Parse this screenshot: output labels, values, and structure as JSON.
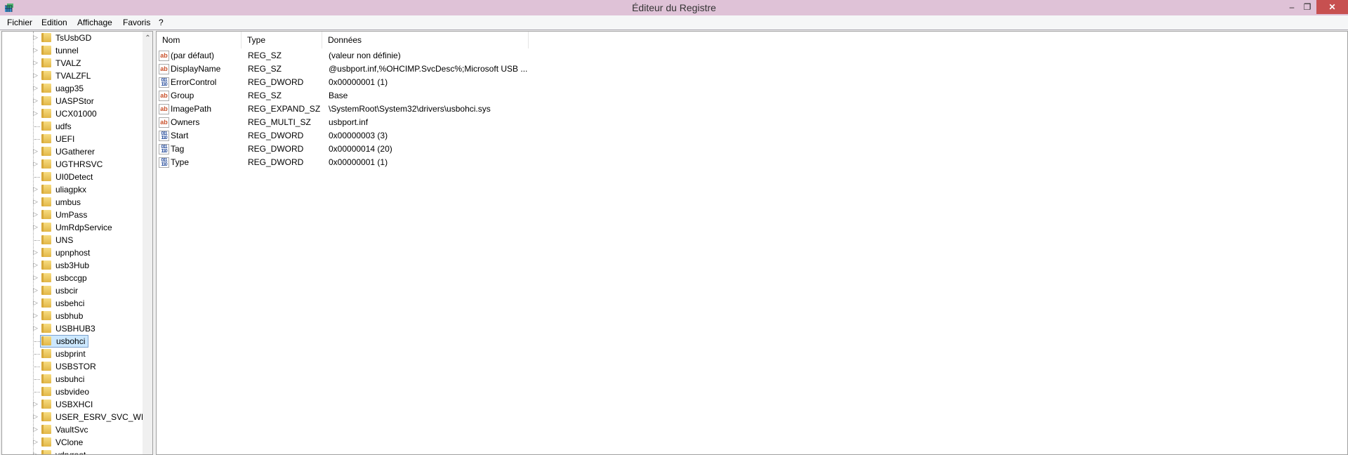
{
  "window": {
    "title": "Éditeur du Registre",
    "minimize": "–",
    "restore": "❐",
    "close": "✕"
  },
  "menu": [
    "Fichier",
    "Edition",
    "Affichage",
    "Favoris",
    "?"
  ],
  "tree": {
    "selected": "usbohci",
    "items": [
      {
        "label": "TsUsbGD",
        "expandable": true
      },
      {
        "label": "tunnel",
        "expandable": true
      },
      {
        "label": "TVALZ",
        "expandable": true
      },
      {
        "label": "TVALZFL",
        "expandable": true
      },
      {
        "label": "uagp35",
        "expandable": true
      },
      {
        "label": "UASPStor",
        "expandable": true
      },
      {
        "label": "UCX01000",
        "expandable": true
      },
      {
        "label": "udfs",
        "expandable": false
      },
      {
        "label": "UEFI",
        "expandable": false
      },
      {
        "label": "UGatherer",
        "expandable": true
      },
      {
        "label": "UGTHRSVC",
        "expandable": true
      },
      {
        "label": "UI0Detect",
        "expandable": false
      },
      {
        "label": "uliagpkx",
        "expandable": true
      },
      {
        "label": "umbus",
        "expandable": true
      },
      {
        "label": "UmPass",
        "expandable": true
      },
      {
        "label": "UmRdpService",
        "expandable": true
      },
      {
        "label": "UNS",
        "expandable": false
      },
      {
        "label": "upnphost",
        "expandable": true
      },
      {
        "label": "usb3Hub",
        "expandable": true
      },
      {
        "label": "usbccgp",
        "expandable": true
      },
      {
        "label": "usbcir",
        "expandable": true
      },
      {
        "label": "usbehci",
        "expandable": true
      },
      {
        "label": "usbhub",
        "expandable": true
      },
      {
        "label": "USBHUB3",
        "expandable": true
      },
      {
        "label": "usbohci",
        "expandable": false
      },
      {
        "label": "usbprint",
        "expandable": false
      },
      {
        "label": "USBSTOR",
        "expandable": false
      },
      {
        "label": "usbuhci",
        "expandable": false
      },
      {
        "label": "usbvideo",
        "expandable": false
      },
      {
        "label": "USBXHCI",
        "expandable": true
      },
      {
        "label": "USER_ESRV_SVC_WILLA",
        "expandable": true
      },
      {
        "label": "VaultSvc",
        "expandable": true
      },
      {
        "label": "VClone",
        "expandable": true
      },
      {
        "label": "vdrvroot",
        "expandable": true
      }
    ]
  },
  "list": {
    "headers": [
      "Nom",
      "Type",
      "Données"
    ],
    "rows": [
      {
        "icon": "ab",
        "name": "(par défaut)",
        "type": "REG_SZ",
        "data": "(valeur non définie)"
      },
      {
        "icon": "ab",
        "name": "DisplayName",
        "type": "REG_SZ",
        "data": "@usbport.inf,%OHCIMP.SvcDesc%;Microsoft USB ..."
      },
      {
        "icon": "dw",
        "name": "ErrorControl",
        "type": "REG_DWORD",
        "data": "0x00000001 (1)"
      },
      {
        "icon": "ab",
        "name": "Group",
        "type": "REG_SZ",
        "data": "Base"
      },
      {
        "icon": "ab",
        "name": "ImagePath",
        "type": "REG_EXPAND_SZ",
        "data": "\\SystemRoot\\System32\\drivers\\usbohci.sys"
      },
      {
        "icon": "ab",
        "name": "Owners",
        "type": "REG_MULTI_SZ",
        "data": "usbport.inf"
      },
      {
        "icon": "dw",
        "name": "Start",
        "type": "REG_DWORD",
        "data": "0x00000003 (3)"
      },
      {
        "icon": "dw",
        "name": "Tag",
        "type": "REG_DWORD",
        "data": "0x00000014 (20)"
      },
      {
        "icon": "dw",
        "name": "Type",
        "type": "REG_DWORD",
        "data": "0x00000001 (1)"
      }
    ]
  }
}
